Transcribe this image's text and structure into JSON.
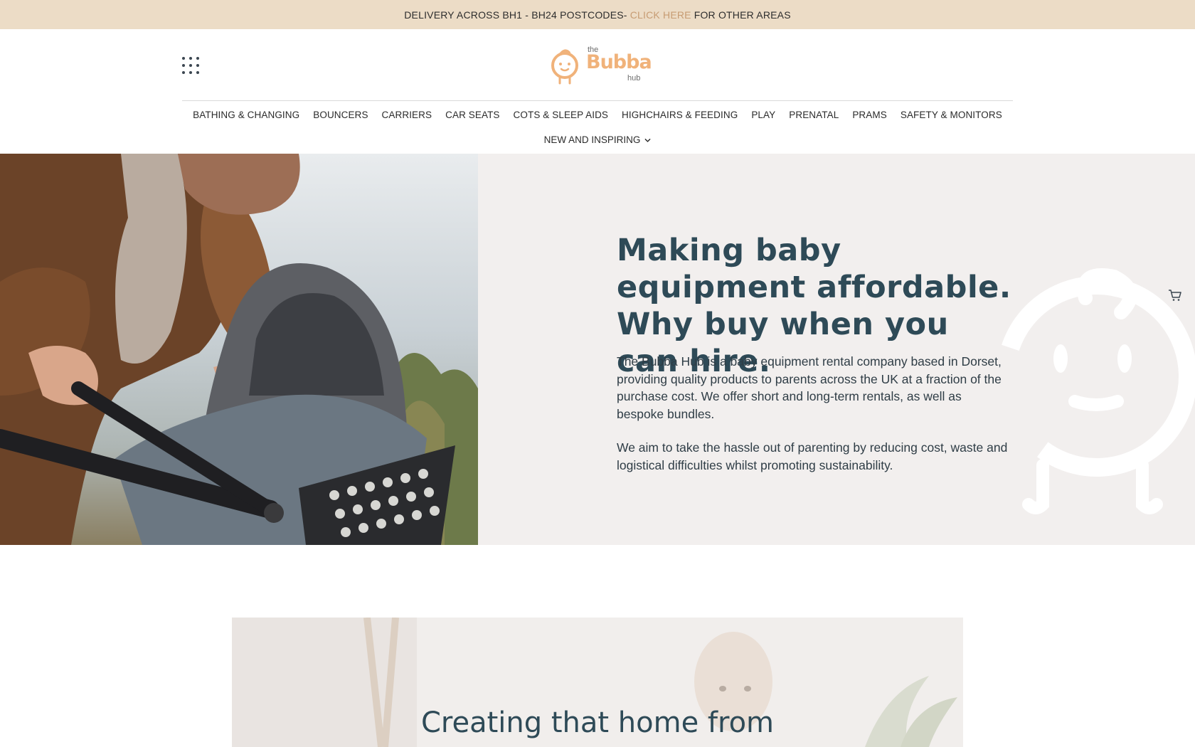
{
  "announcement": {
    "prefix": "DELIVERY ACROSS BH1 - BH24 POSTCODES-",
    "link": "CLICK HERE",
    "suffix": "FOR OTHER AREAS"
  },
  "logo": {
    "the": "the",
    "word": "Bubba",
    "hub": "hub"
  },
  "nav": {
    "items": [
      "BATHING & CHANGING",
      "BOUNCERS",
      "CARRIERS",
      "CAR SEATS",
      "COTS & SLEEP AIDS",
      "HIGHCHAIRS & FEEDING",
      "PLAY",
      "PRENATAL",
      "PRAMS",
      "SAFETY & MONITORS"
    ],
    "dropdown": "NEW AND INSPIRING"
  },
  "hero": {
    "title": "Making baby equipment affordable. Why buy when you can hire.",
    "paragraph1": "The Bubba Hub is a baby equipment rental company based in Dorset, providing quality products to parents across the UK at a fraction of the purchase cost. We offer short and long-term rentals, as well as bespoke bundles.",
    "paragraph2": "We aim to take the hassle out of parenting by reducing cost, waste and logistical difficulties whilst promoting sustainability."
  },
  "section2": {
    "title": "Creating that home from"
  },
  "colors": {
    "announcement_bg": "#ecdcc6",
    "link_accent": "#c79c73",
    "hero_bg": "#f2efee",
    "heading": "#2e4a57",
    "logo_orange": "#f0b27a",
    "logo_pink": "#e8a99c"
  }
}
